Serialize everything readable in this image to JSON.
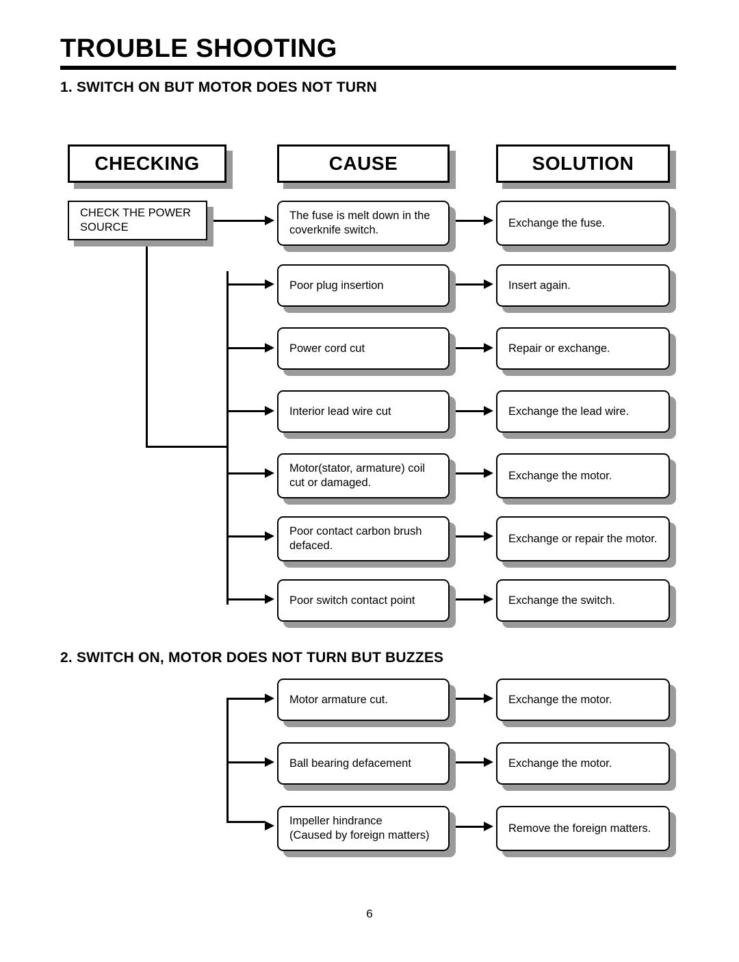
{
  "document": {
    "title": "TROUBLE SHOOTING",
    "page_number": "6"
  },
  "columns": {
    "checking": "CHECKING",
    "cause": "CAUSE",
    "solution": "SOLUTION"
  },
  "sections": [
    {
      "heading": "1. SWITCH ON BUT MOTOR DOES NOT TURN",
      "checking": [
        {
          "label": "CHECK THE POWER\nSOURCE"
        }
      ],
      "rows": [
        {
          "cause": "The fuse is melt down in the\ncoverknife switch.",
          "solution": "Exchange the fuse."
        },
        {
          "cause": "Poor plug insertion",
          "solution": "Insert again."
        },
        {
          "cause": "Power cord cut",
          "solution": "Repair or exchange."
        },
        {
          "cause": "Interior lead wire cut",
          "solution": "Exchange the lead wire."
        },
        {
          "cause": "Motor(stator, armature) coil\ncut or damaged.",
          "solution": "Exchange the motor."
        },
        {
          "cause": "Poor contact carbon brush\ndefaced.",
          "solution": "Exchange or repair the motor."
        },
        {
          "cause": "Poor switch contact point",
          "solution": "Exchange the switch."
        }
      ]
    },
    {
      "heading": "2. SWITCH ON, MOTOR DOES NOT TURN BUT BUZZES",
      "checking": [],
      "rows": [
        {
          "cause": "Motor armature cut.",
          "solution": "Exchange the motor."
        },
        {
          "cause": "Ball bearing defacement",
          "solution": "Exchange the motor."
        },
        {
          "cause": "Impeller hindrance\n(Caused by foreign matters)",
          "solution": "Remove the foreign matters."
        }
      ]
    }
  ],
  "colors": {
    "line": "#000000",
    "shadow": "#9a9a9a",
    "background": "#ffffff"
  }
}
